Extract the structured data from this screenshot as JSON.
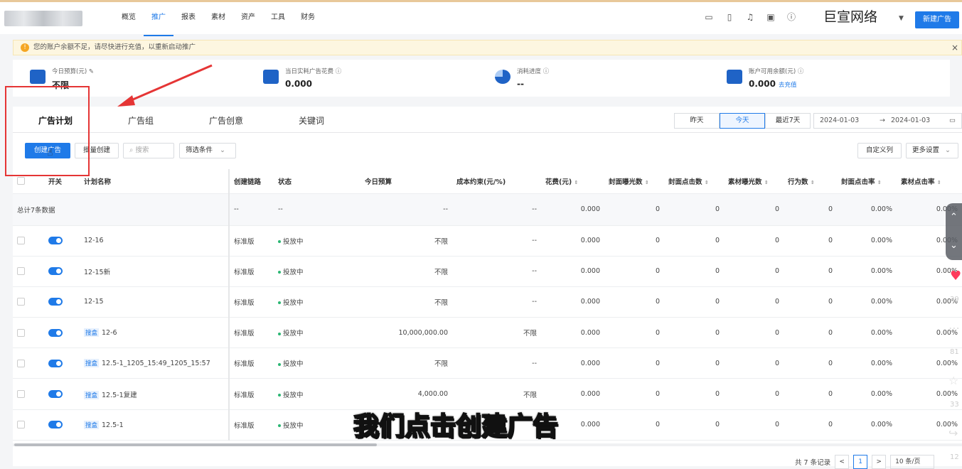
{
  "header": {
    "nav": [
      "概览",
      "推广",
      "报表",
      "素材",
      "资产",
      "工具",
      "财务"
    ],
    "active_nav": "推广",
    "brand": "巨宣网络",
    "new_ad_button": "新建广告",
    "icons": [
      "tablet-icon",
      "phone-icon",
      "bell-icon",
      "message-icon",
      "help-icon"
    ]
  },
  "notice": {
    "text": "您的账户余额不足，请尽快进行充值，以重新启动推广",
    "close": "×"
  },
  "stats": [
    {
      "label": "今日预算(元)",
      "value": "不限",
      "icon": "budget-icon"
    },
    {
      "label": "当日实耗广告花费",
      "value": "0.000",
      "icon": "wallet-icon"
    },
    {
      "label": "消耗进度",
      "value": "--",
      "icon": "pie-icon"
    },
    {
      "label": "账户可用余额(元)",
      "value": "0.000",
      "link": "去充值",
      "icon": "balance-icon"
    }
  ],
  "tabs": [
    "广告计划",
    "广告组",
    "广告创意",
    "关键词"
  ],
  "date_buttons": [
    "昨天",
    "今天",
    "最近7天"
  ],
  "date_range": {
    "start": "2024-01-03",
    "sep": "→",
    "end": "2024-01-03"
  },
  "toolbar": {
    "create": "创建广告",
    "batch_create": "批量创建",
    "search_placeholder": "搜索",
    "filter": "筛选条件",
    "custom_columns": "自定义列",
    "more_settings": "更多设置"
  },
  "table": {
    "headers": [
      "开关",
      "计划名称",
      "创建链路",
      "状态",
      "今日预算",
      "成本约束(元/%)",
      "花费(元)",
      "封面曝光数",
      "封面点击数",
      "素材曝光数",
      "行为数",
      "封面点击率",
      "素材点击率"
    ],
    "total": {
      "label": "总计7条数据",
      "values": [
        "--",
        "--",
        "--",
        "--",
        "0.000",
        "0",
        "0",
        "0",
        "0",
        "0.00%",
        "0.00%"
      ]
    },
    "rows": [
      {
        "tag": "",
        "name": "12-16",
        "chain": "标准版",
        "status": "投放中",
        "budget": "不限",
        "cost": "--",
        "spend": "0.000",
        "c1": "0",
        "c2": "0",
        "c3": "0",
        "c4": "0",
        "r1": "0.00%",
        "r2": "0.00%"
      },
      {
        "tag": "",
        "name": "12-15新",
        "chain": "标准版",
        "status": "投放中",
        "budget": "不限",
        "cost": "--",
        "spend": "0.000",
        "c1": "0",
        "c2": "0",
        "c3": "0",
        "c4": "0",
        "r1": "0.00%",
        "r2": "0.00%"
      },
      {
        "tag": "",
        "name": "12-15",
        "chain": "标准版",
        "status": "投放中",
        "budget": "不限",
        "cost": "--",
        "spend": "0.000",
        "c1": "0",
        "c2": "0",
        "c3": "0",
        "c4": "0",
        "r1": "0.00%",
        "r2": "0.00%"
      },
      {
        "tag": "搜盒",
        "name": "12-6",
        "chain": "标准版",
        "status": "投放中",
        "budget": "10,000,000.00",
        "cost": "不限",
        "spend": "0.000",
        "c1": "0",
        "c2": "0",
        "c3": "0",
        "c4": "0",
        "r1": "0.00%",
        "r2": "0.00%"
      },
      {
        "tag": "搜盒",
        "name": "12.5-1_1205_15:49_1205_15:57",
        "chain": "标准版",
        "status": "投放中",
        "budget": "不限",
        "cost": "--",
        "spend": "0.000",
        "c1": "0",
        "c2": "0",
        "c3": "0",
        "c4": "0",
        "r1": "0.00%",
        "r2": "0.00%"
      },
      {
        "tag": "搜盒",
        "name": "12.5-1复建",
        "chain": "标准版",
        "status": "投放中",
        "budget": "4,000.00",
        "cost": "不限",
        "spend": "0.000",
        "c1": "0",
        "c2": "0",
        "c3": "0",
        "c4": "0",
        "r1": "0.00%",
        "r2": "0.00%"
      },
      {
        "tag": "搜盒",
        "name": "12.5-1",
        "chain": "标准版",
        "status": "投放中",
        "budget": "不限",
        "cost": "--",
        "spend": "0.000",
        "c1": "0",
        "c2": "0",
        "c3": "0",
        "c4": "0",
        "r1": "0.00%",
        "r2": "0.00%"
      }
    ]
  },
  "pager": {
    "summary": "共 7 条记录",
    "prev": "<",
    "page": "1",
    "next": ">",
    "page_size": "10 条/页"
  },
  "subtitle": "我们点击创建广告",
  "side_overlay": {
    "counts": [
      "39",
      "81",
      "33",
      "12"
    ]
  },
  "annotation_color": "#e53535",
  "accent": "#1f7ae8"
}
